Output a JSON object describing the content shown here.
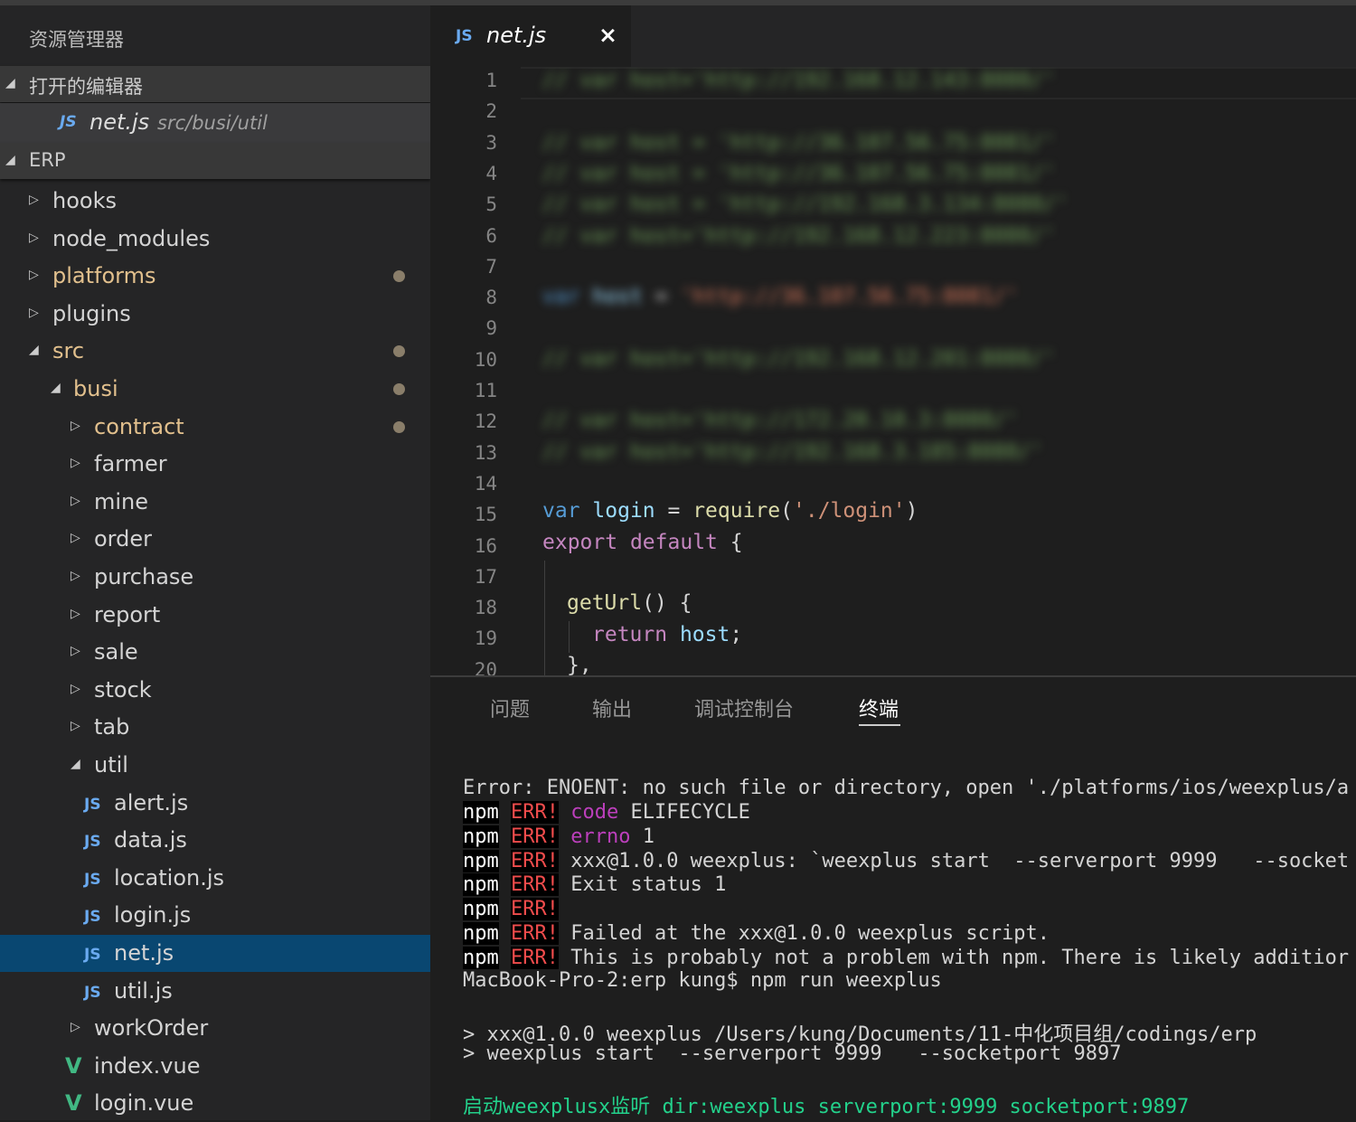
{
  "sidebar": {
    "explorer_title": "资源管理器",
    "open_editors": {
      "label": "打开的编辑器",
      "items": [
        {
          "icon": "JS",
          "name": "net.js",
          "path": "src/busi/util"
        }
      ]
    },
    "project": {
      "label": "ERP",
      "tree": [
        {
          "name": "hooks",
          "type": "folder",
          "state": "collapsed",
          "depth": 0,
          "modified": false,
          "selected": false
        },
        {
          "name": "node_modules",
          "type": "folder",
          "state": "collapsed",
          "depth": 0,
          "modified": false,
          "selected": false
        },
        {
          "name": "platforms",
          "type": "folder",
          "state": "collapsed",
          "depth": 0,
          "modified": true,
          "selected": false
        },
        {
          "name": "plugins",
          "type": "folder",
          "state": "collapsed",
          "depth": 0,
          "modified": false,
          "selected": false
        },
        {
          "name": "src",
          "type": "folder",
          "state": "expanded",
          "depth": 0,
          "modified": true,
          "selected": false
        },
        {
          "name": "busi",
          "type": "folder",
          "state": "expanded",
          "depth": 1,
          "modified": true,
          "selected": false
        },
        {
          "name": "contract",
          "type": "folder",
          "state": "collapsed",
          "depth": 2,
          "modified": true,
          "selected": false
        },
        {
          "name": "farmer",
          "type": "folder",
          "state": "collapsed",
          "depth": 2,
          "modified": false,
          "selected": false
        },
        {
          "name": "mine",
          "type": "folder",
          "state": "collapsed",
          "depth": 2,
          "modified": false,
          "selected": false
        },
        {
          "name": "order",
          "type": "folder",
          "state": "collapsed",
          "depth": 2,
          "modified": false,
          "selected": false
        },
        {
          "name": "purchase",
          "type": "folder",
          "state": "collapsed",
          "depth": 2,
          "modified": false,
          "selected": false
        },
        {
          "name": "report",
          "type": "folder",
          "state": "collapsed",
          "depth": 2,
          "modified": false,
          "selected": false
        },
        {
          "name": "sale",
          "type": "folder",
          "state": "collapsed",
          "depth": 2,
          "modified": false,
          "selected": false
        },
        {
          "name": "stock",
          "type": "folder",
          "state": "collapsed",
          "depth": 2,
          "modified": false,
          "selected": false
        },
        {
          "name": "tab",
          "type": "folder",
          "state": "collapsed",
          "depth": 2,
          "modified": false,
          "selected": false
        },
        {
          "name": "util",
          "type": "folder",
          "state": "expanded",
          "depth": 2,
          "modified": false,
          "selected": false
        },
        {
          "name": "alert.js",
          "type": "js",
          "depth": 3,
          "modified": false,
          "selected": false
        },
        {
          "name": "data.js",
          "type": "js",
          "depth": 3,
          "modified": false,
          "selected": false
        },
        {
          "name": "location.js",
          "type": "js",
          "depth": 3,
          "modified": false,
          "selected": false
        },
        {
          "name": "login.js",
          "type": "js",
          "depth": 3,
          "modified": false,
          "selected": false
        },
        {
          "name": "net.js",
          "type": "js",
          "depth": 3,
          "modified": false,
          "selected": true
        },
        {
          "name": "util.js",
          "type": "js",
          "depth": 3,
          "modified": false,
          "selected": false
        },
        {
          "name": "workOrder",
          "type": "folder",
          "state": "collapsed",
          "depth": 2,
          "modified": false,
          "selected": false
        },
        {
          "name": "index.vue",
          "type": "vue",
          "depth": 2,
          "modified": false,
          "selected": false
        },
        {
          "name": "login.vue",
          "type": "vue",
          "depth": 2,
          "modified": false,
          "selected": false
        }
      ]
    }
  },
  "editor": {
    "tab": {
      "icon": "JS",
      "name": "net.js",
      "close": "×"
    },
    "line_numbers": [
      "1",
      "2",
      "3",
      "4",
      "5",
      "6",
      "7",
      "8",
      "9",
      "10",
      "11",
      "12",
      "13",
      "14",
      "15",
      "16",
      "17",
      "18",
      "19",
      "20"
    ],
    "blurred_lines": {
      "l1": {
        "a": "// var host='http://192.168.12.143:8080/'"
      },
      "l3": {
        "a": "// var host = 'http://36.107.56.75:8081/'"
      },
      "l4": {
        "a": "// var host = 'http://36.107.56.75:8081/'"
      },
      "l5": {
        "a": "// var host = 'http://192.168.3.134:8080/'"
      },
      "l6": {
        "a": "// var host='http://192.168.12.223:8080/'"
      },
      "l8": {
        "kw": "var",
        "v": "host",
        "op": " = ",
        "s": "'http://36.107.56.75:8081/'"
      },
      "l10": {
        "a": "// var host='http://192.168.12.201:8080/'"
      },
      "l12": {
        "a": "// var host='http://172.20.10.3:8080/'"
      },
      "l13": {
        "a": "// var host='http://192.168.3.185:8080/'"
      }
    },
    "code": {
      "l15": {
        "kw": "var",
        "v": "login",
        "op": " = ",
        "fn": "require",
        "p1": "(",
        "s": "'./login'",
        "p2": ")"
      },
      "l16": {
        "kw": "export",
        "kw2": "default",
        "rest": " {"
      },
      "l18": {
        "fn": "getUrl",
        "rest": "() {"
      },
      "l19": {
        "kw": "return",
        "v": "host",
        "rest": ";"
      },
      "l20": {
        "rest": "},"
      }
    }
  },
  "panel": {
    "tabs": [
      "问题",
      "输出",
      "调试控制台",
      "终端"
    ],
    "active_tab": "终端",
    "terminal": {
      "error_line": "Error: ENOENT: no such file or directory, open './platforms/ios/weexplus/a",
      "npm": "npm",
      "err": "ERR!",
      "npm_lines": [
        {
          "key": "code",
          "text": " ELIFECYCLE"
        },
        {
          "key": "errno",
          "text": " 1"
        },
        {
          "key": "",
          "text": "xxx@1.0.0 weexplus: `weexplus start  --serverport 9999   --socket"
        },
        {
          "key": "",
          "text": "Exit status 1"
        },
        {
          "key": "",
          "text": ""
        },
        {
          "key": "",
          "text": "Failed at the xxx@1.0.0 weexplus script."
        },
        {
          "key": "",
          "text": "This is probably not a problem with npm. There is likely additior"
        }
      ],
      "prompt_line": "MacBook-Pro-2:erp kung$ npm run weexplus",
      "out1": "> xxx@1.0.0 weexplus /Users/kung/Documents/11-中化项目组/codings/erp",
      "out2": "> weexplus start  --serverport 9999   --socketport 9897",
      "green_line": "启动weexplusx监听 dir:weexplus serverport:9999 socketport:9897"
    }
  },
  "colors": {
    "selection": "#094771",
    "modified": "#e2c08d",
    "js_icon": "#6aaaf0",
    "vue_icon": "#41b883",
    "err_red": "#f14c4c",
    "magenta": "#bc3fbc",
    "green": "#23d18b"
  }
}
